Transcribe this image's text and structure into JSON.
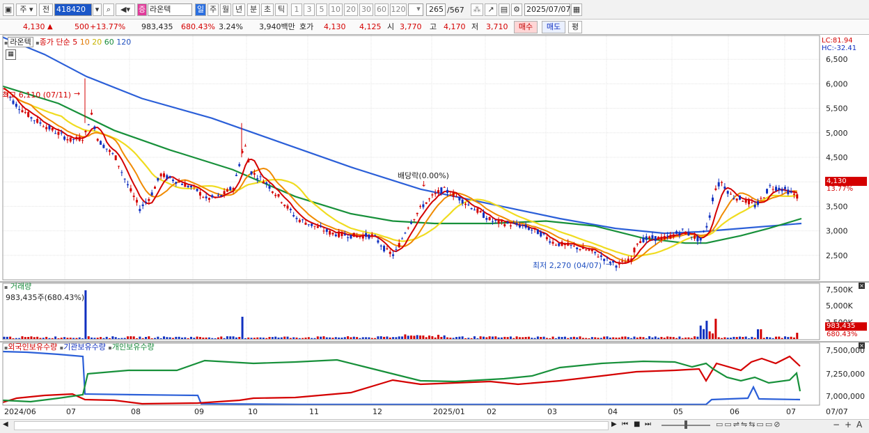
{
  "toolbar": {
    "market": "주",
    "prev_label": "전",
    "code": "418420",
    "name": "라온텍",
    "period_buttons": [
      "일",
      "주",
      "월",
      "년",
      "분",
      "초",
      "틱"
    ],
    "interval_buttons": [
      "1",
      "3",
      "5",
      "10",
      "20",
      "30",
      "60",
      "120"
    ],
    "count": "265",
    "total": "/567",
    "date": "2025/07/07"
  },
  "quote": {
    "price": "4,130",
    "change": "500",
    "change_pct": "+13.77%",
    "volume": "983,435",
    "volume_pct": "680.43%",
    "turnover_pct": "3.24%",
    "amount": "3,940백만",
    "ask_label": "호가",
    "ask": "4,130",
    "bid": "4,125",
    "open_label": "시",
    "open": "3,770",
    "high_label": "고",
    "high": "4,170",
    "low_label": "저",
    "low": "3,710",
    "buy_btn": "매수",
    "sell_btn": "매도",
    "eval_btn": "평"
  },
  "price_panel": {
    "name": "라온텍",
    "legend_label": "종가 단순",
    "ma": [
      "5",
      "10",
      "20",
      "60",
      "120"
    ],
    "lc": "LC:81.94",
    "hc": "HC:-32.41",
    "yticks": [
      "6,500",
      "6,000",
      "5,500",
      "5,000",
      "4,500",
      "4,000",
      "3,500",
      "3,000",
      "2,500"
    ],
    "current": "4,130",
    "current_pct": "13.77%",
    "high_note": "최고 6,110 (07/11)",
    "low_note": "최저 2,270 (04/07)",
    "dividend_note": "배당락(0.00%)"
  },
  "volume_panel": {
    "title": "거래량",
    "value": "983,435주(680.43%)",
    "yticks": [
      "7,500K",
      "5,000K",
      "2,500K"
    ],
    "current": "983,435",
    "current_pct": "680.43%"
  },
  "holding_panel": {
    "legend": [
      "외국인보유수량",
      "기관보유수량",
      "개인보유수량"
    ],
    "yticks": [
      "7,500,000",
      "7,250,000",
      "7,000,000"
    ]
  },
  "xaxis": [
    "2024/06",
    "07",
    "08",
    "09",
    "10",
    "11",
    "12",
    "2025/01",
    "02",
    "03",
    "04",
    "05",
    "06",
    "07"
  ],
  "xaxis_right": "07/07",
  "colors": {
    "up": "#d40000",
    "down": "#1030c0",
    "ma5": "#d40000",
    "ma10": "#f08a00",
    "ma20": "#f0dc20",
    "ma60": "#17903a",
    "ma120": "#2b5fd8"
  }
}
